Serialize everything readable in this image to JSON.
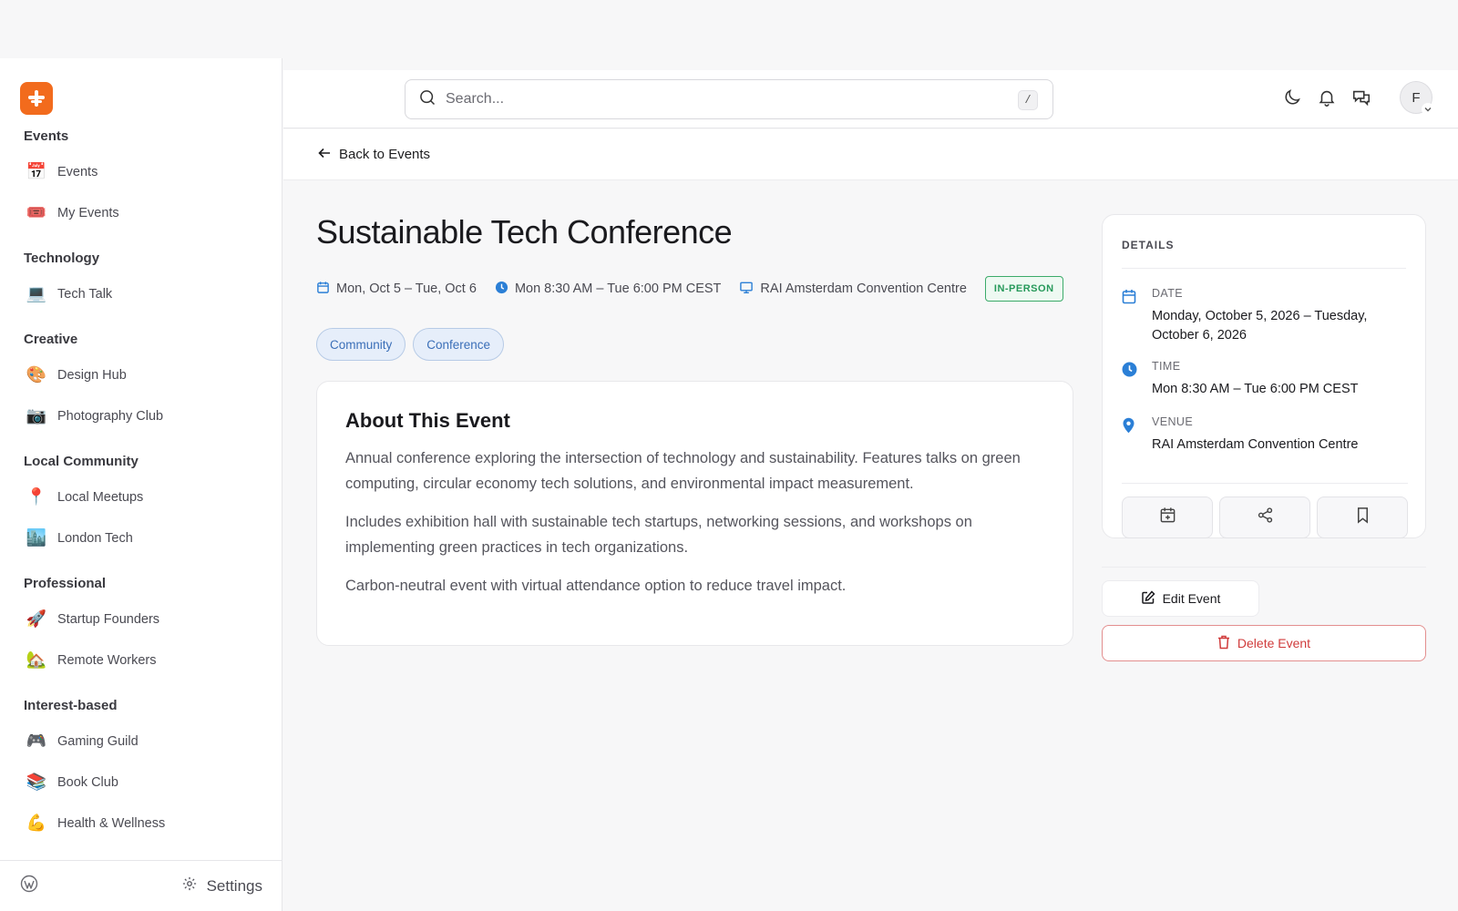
{
  "colors": {
    "brand": "#f26b1d",
    "accent_blue": "#2b7fd6",
    "in_person_green": "#26995a",
    "delete_red": "#d03b3b",
    "tag_bg": "#e6eefa"
  },
  "header": {
    "search_placeholder": "Search...",
    "search_shortcut": "/",
    "avatar_initial": "F",
    "icons": [
      "moon-icon",
      "bell-icon",
      "chat-icon"
    ]
  },
  "sidebar": {
    "groups": [
      {
        "title": "Events",
        "items": [
          {
            "icon": "📅",
            "label": "Events"
          },
          {
            "icon": "🎟️",
            "label": "My Events"
          }
        ]
      },
      {
        "title": "Technology",
        "items": [
          {
            "icon": "💻",
            "label": "Tech Talk"
          }
        ]
      },
      {
        "title": "Creative",
        "items": [
          {
            "icon": "🎨",
            "label": "Design Hub"
          },
          {
            "icon": "📷",
            "label": "Photography Club"
          }
        ]
      },
      {
        "title": "Local Community",
        "items": [
          {
            "icon": "📍",
            "label": "Local Meetups"
          },
          {
            "icon": "🏙️",
            "label": "London Tech"
          }
        ]
      },
      {
        "title": "Professional",
        "items": [
          {
            "icon": "🚀",
            "label": "Startup Founders"
          },
          {
            "icon": "🏡",
            "label": "Remote Workers"
          }
        ]
      },
      {
        "title": "Interest-based",
        "items": [
          {
            "icon": "🎮",
            "label": "Gaming Guild"
          },
          {
            "icon": "📚",
            "label": "Book Club"
          },
          {
            "icon": "💪",
            "label": "Health & Wellness"
          }
        ]
      }
    ],
    "footer": {
      "settings_label": "Settings"
    }
  },
  "back_link": "Back to Events",
  "event": {
    "title": "Sustainable Tech Conference",
    "date_short": "Mon, Oct 5 – Tue, Oct 6",
    "time_short": "Mon 8:30 AM – Tue 6:00 PM CEST",
    "venue_short": "RAI Amsterdam Convention Centre",
    "badge": "IN-PERSON",
    "tags": [
      "Community",
      "Conference"
    ],
    "about_title": "About This Event",
    "about_paragraphs": [
      "Annual conference exploring the intersection of technology and sustainability. Features talks on green computing, circular economy tech solutions, and environmental impact measurement.",
      "Includes exhibition hall with sustainable tech startups, networking sessions, and workshops on implementing green practices in tech organizations.",
      "Carbon-neutral event with virtual attendance option to reduce travel impact."
    ]
  },
  "details": {
    "heading": "DETAILS",
    "date_label": "DATE",
    "date_value": "Monday, October 5, 2026 – Tuesday, October 6, 2026",
    "time_label": "TIME",
    "time_value": "Mon 8:30 AM – Tue 6:00 PM CEST",
    "venue_label": "VENUE",
    "venue_value": "RAI Amsterdam Convention Centre"
  },
  "buttons": {
    "edit": "Edit Event",
    "delete": "Delete Event"
  }
}
